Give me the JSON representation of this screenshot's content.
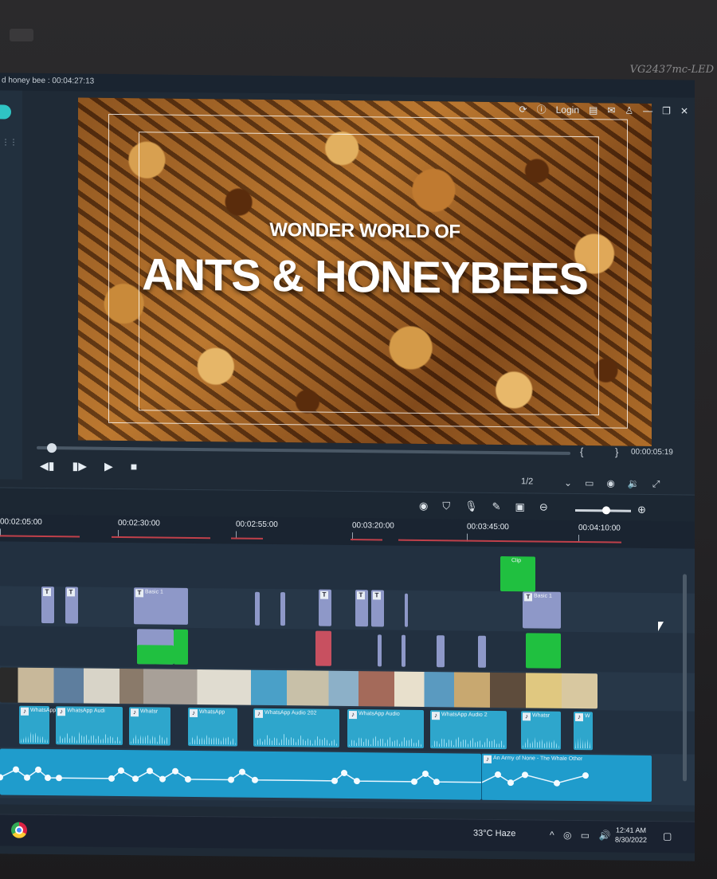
{
  "monitor": {
    "model": "VG2437mc-LED"
  },
  "window": {
    "title": "d honey bee : 00:04:27:13"
  },
  "toolbar": {
    "login": "Login"
  },
  "preview": {
    "subtitle": "WONDER WORLD OF",
    "title": "ANTS & HONEYBEES",
    "brackets": "{ }",
    "timecode": "00:00:05:19",
    "ratio": "1/2",
    "progress": 0.02
  },
  "timeline": {
    "ruler": [
      "00:02:05:00",
      "00:02:30:00",
      "00:02:55:00",
      "00:03:20:00",
      "00:03:45:00",
      "00:04:10:00"
    ],
    "clips": {
      "title_basic1": "Basic 1",
      "title_basic2": "Basic 1",
      "green": "Clip",
      "audio": [
        "WhatsApp Au",
        "WhatsApp Audi",
        "Whatsr",
        "WhatsApp",
        "WhatsApp Audio 202",
        "WhatsApp Audio",
        "WhatsApp Audio 2",
        "Whatsr",
        "W"
      ],
      "music": "An Army of None - The Whale Other"
    }
  },
  "taskbar": {
    "weather": "33°C Haze",
    "time": "12:41 AM",
    "date": "8/30/2022"
  },
  "colors": {
    "accent": "#2fc4c4",
    "audio_clip": "#2ea6cc",
    "title_clip": "#8e98c8",
    "green_clip": "#20c040"
  }
}
